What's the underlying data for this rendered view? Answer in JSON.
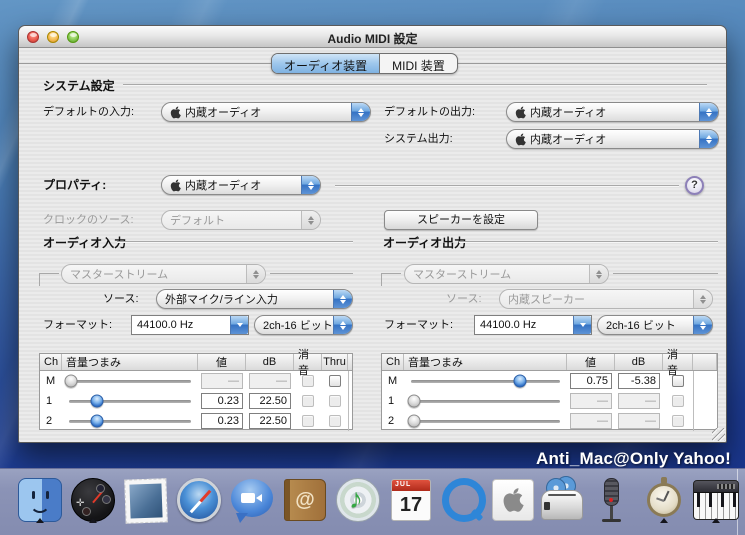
{
  "window": {
    "title": "Audio MIDI 設定"
  },
  "tabs": {
    "audio": "オーディオ装置",
    "midi": "MIDI 装置"
  },
  "system": {
    "header": "システム設定",
    "default_input_label": "デフォルトの入力:",
    "default_input_value": "内蔵オーディオ",
    "default_output_label": "デフォルトの出力:",
    "default_output_value": "内蔵オーディオ",
    "system_output_label": "システム出力:",
    "system_output_value": "内蔵オーディオ"
  },
  "properties": {
    "label": "プロパティ:",
    "value": "内蔵オーディオ",
    "help_label": "?",
    "clock_label": "クロックのソース:",
    "clock_value": "デフォルト",
    "speaker_button": "スピーカーを設定"
  },
  "audio_input": {
    "header": "オーディオ入力",
    "stream": "マスターストリーム",
    "source_label": "ソース:",
    "source_value": "外部マイク/ライン入力",
    "format_label": "フォーマット:",
    "rate": "44100.0 Hz",
    "depth": "2ch-16 ビット",
    "table": {
      "headers": [
        "Ch",
        "音量つまみ",
        "値",
        "dB",
        "消音",
        "Thru"
      ],
      "rows": [
        {
          "ch": "M",
          "value": "—",
          "db": "—",
          "slider": 0.02
        },
        {
          "ch": "1",
          "value": "0.23",
          "db": "22.50",
          "slider": 0.23
        },
        {
          "ch": "2",
          "value": "0.23",
          "db": "22.50",
          "slider": 0.23
        }
      ]
    }
  },
  "audio_output": {
    "header": "オーディオ出力",
    "stream": "マスターストリーム",
    "source_label": "ソース:",
    "source_value": "内蔵スピーカー",
    "format_label": "フォーマット:",
    "rate": "44100.0 Hz",
    "depth": "2ch-16 ビット",
    "table": {
      "headers": [
        "Ch",
        "音量つまみ",
        "値",
        "dB",
        "消音"
      ],
      "rows": [
        {
          "ch": "M",
          "value": "0.75",
          "db": "-5.38",
          "slider": 0.73
        },
        {
          "ch": "1",
          "value": "—",
          "db": "—",
          "slider": 0.02
        },
        {
          "ch": "2",
          "value": "—",
          "db": "—",
          "slider": 0.02
        }
      ]
    }
  },
  "desktop": {
    "watermark": "Anti_Mac@Only Yahoo!"
  },
  "dock": {
    "items": [
      "finder",
      "dashboard",
      "mail",
      "safari",
      "ichat",
      "address-book",
      "itunes",
      "ical",
      "quicktime",
      "apple-box",
      "toast",
      "microphone",
      "stopwatch",
      "midi-keyboard"
    ],
    "running": [
      "finder",
      "dashboard",
      "stopwatch",
      "midi-keyboard"
    ],
    "ical_month": "JUL",
    "ical_day": "17",
    "address_book_glyph": "@",
    "itunes_glyph": "♪"
  },
  "colors": {
    "aqua_blue": "#3572c4",
    "tab_selected": "#9ec7ec",
    "desktop_top": "#6396c5",
    "desktop_bottom": "#152f86",
    "dock_bg": "#8b93b6"
  }
}
